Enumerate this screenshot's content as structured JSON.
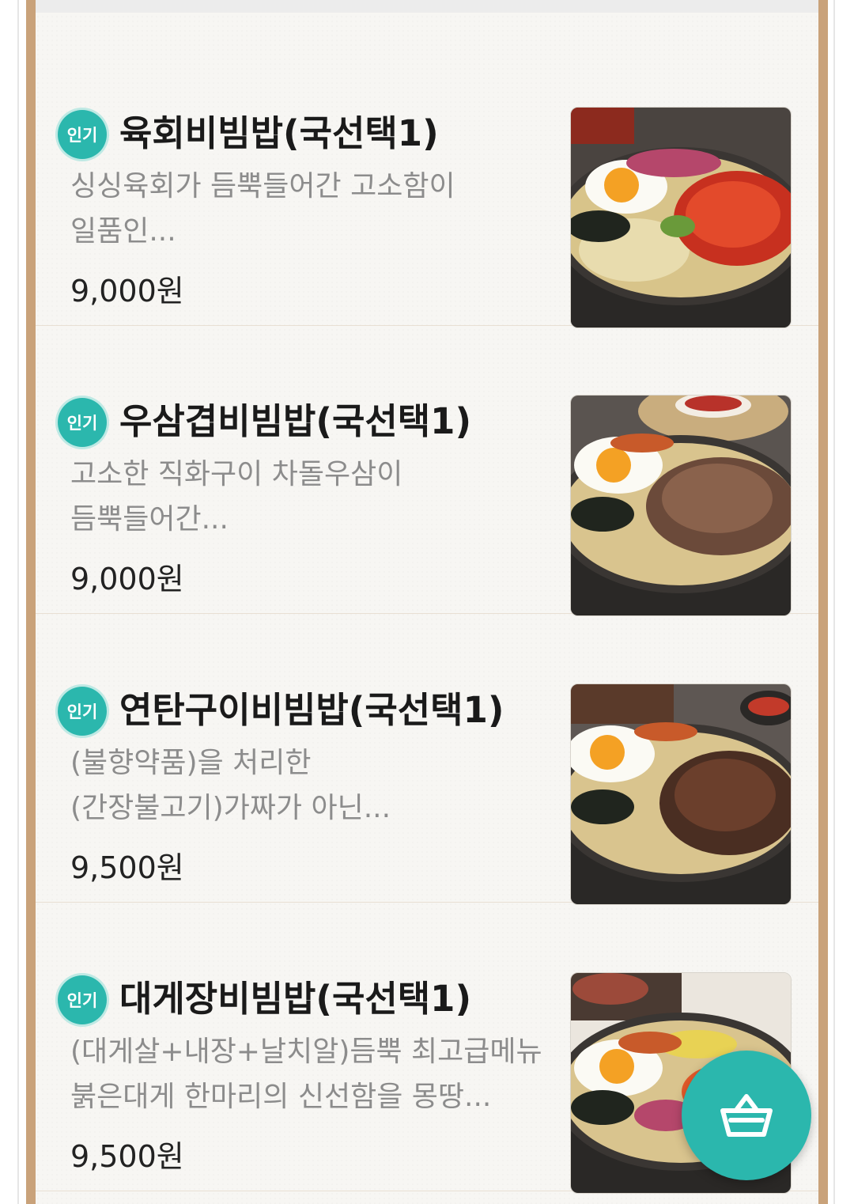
{
  "menu_items": [
    {
      "badge": "인기",
      "name": "육회비빔밥(국선택1)",
      "desc_line1": "싱싱육회가 듬뿍들어간 고소함이",
      "desc_line2": "일품인...",
      "price": "9,000원",
      "topping": "yukhoe"
    },
    {
      "badge": "인기",
      "name": "우삼겹비빔밥(국선택1)",
      "desc_line1": "고소한 직화구이 차돌우삼이",
      "desc_line2": "듬뿍들어간...",
      "price": "9,000원",
      "topping": "beef-brisket"
    },
    {
      "badge": "인기",
      "name": "연탄구이비빔밥(국선택1)",
      "desc_line1": "(불향약품)을 처리한",
      "desc_line2": "(간장불고기)가짜가 아닌...",
      "price": "9,500원",
      "topping": "bulgogi"
    },
    {
      "badge": "인기",
      "name": "대게장비빔밥(국선택1)",
      "desc_line1": "(대게살+내장+날치알)듬뿍 최고급메뉴",
      "desc_line2": "붉은대게 한마리의 신선함을 몽땅...",
      "price": "9,500원",
      "topping": "snow-crab"
    }
  ],
  "cart_button": {
    "icon": "shopping-basket-icon"
  },
  "colors": {
    "accent": "#2bb7ad",
    "frame": "#c9a27a",
    "background": "#f7f6f3",
    "text_primary": "#1a1a1a",
    "text_secondary": "#8c8c8c"
  }
}
